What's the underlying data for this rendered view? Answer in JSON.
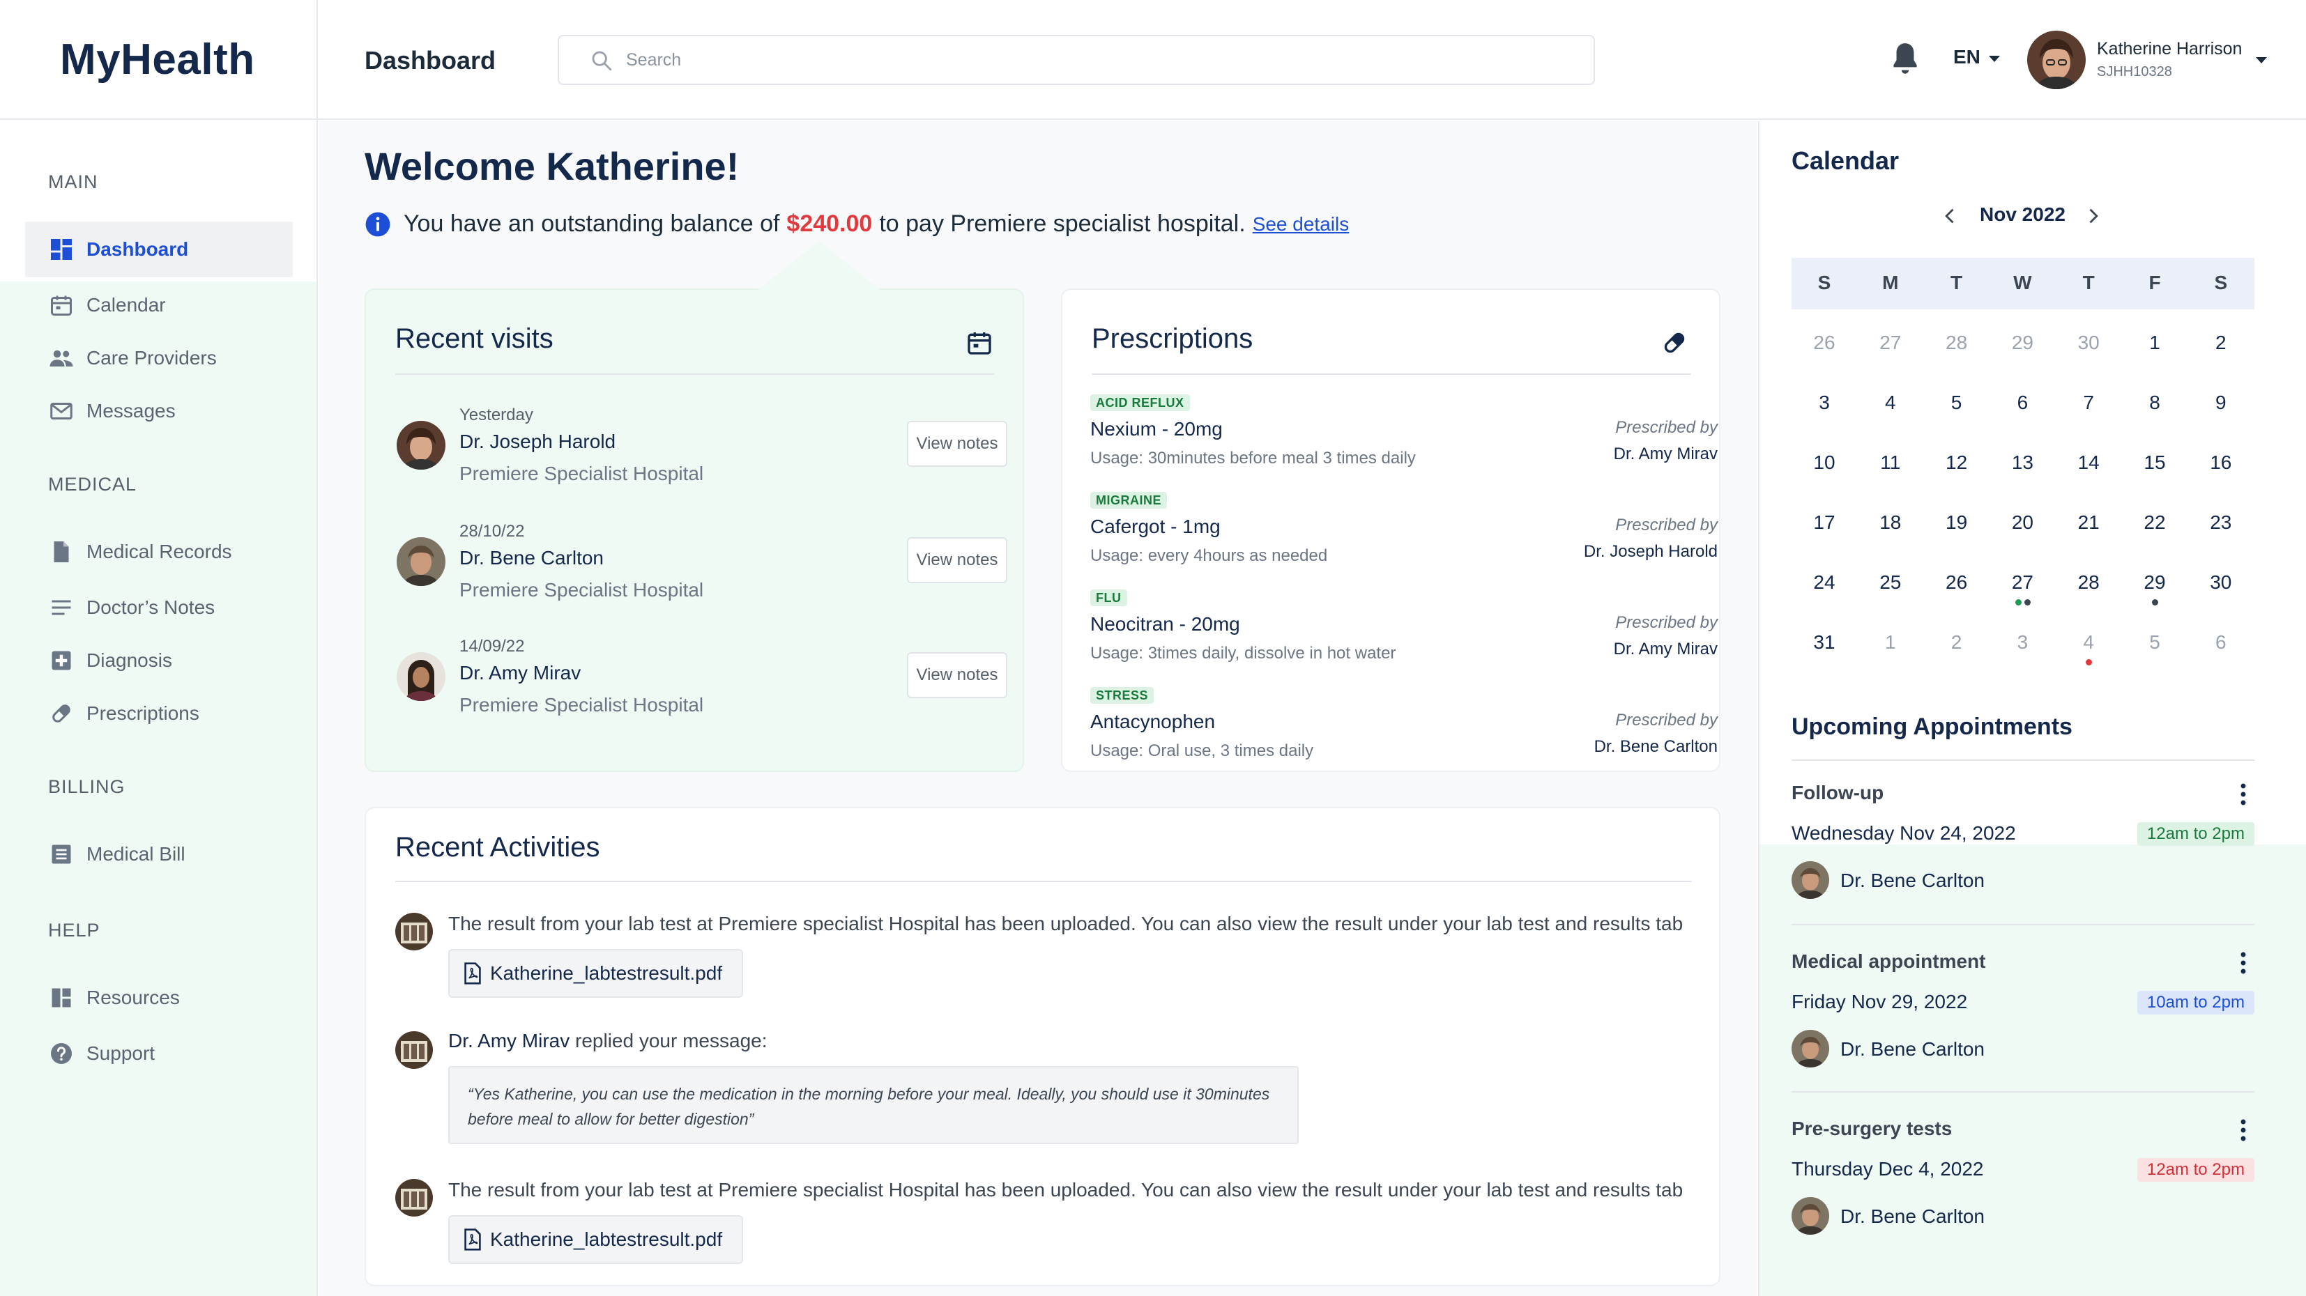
{
  "app": {
    "brand": "MyHealth",
    "page_title": "Dashboard"
  },
  "search": {
    "placeholder": "Search"
  },
  "header": {
    "language": "EN",
    "user_name": "Katherine Harrison",
    "user_id": "SJHH10328"
  },
  "sidebar": {
    "sections": [
      "MAIN",
      "MEDICAL",
      "BILLING",
      "HELP"
    ],
    "items": [
      {
        "label": "Dashboard",
        "icon": "dashboard-icon"
      },
      {
        "label": "Calendar",
        "icon": "calendar-icon"
      },
      {
        "label": "Care Providers",
        "icon": "people-icon"
      },
      {
        "label": "Messages",
        "icon": "mail-icon"
      },
      {
        "label": "Medical Records",
        "icon": "document-icon"
      },
      {
        "label": "Doctor’s Notes",
        "icon": "notes-icon"
      },
      {
        "label": "Diagnosis",
        "icon": "medical-plus-icon"
      },
      {
        "label": "Prescriptions",
        "icon": "pill-icon"
      },
      {
        "label": "Medical Bill",
        "icon": "bill-icon"
      },
      {
        "label": "Resources",
        "icon": "resources-icon"
      },
      {
        "label": "Support",
        "icon": "help-icon"
      }
    ]
  },
  "welcome": {
    "title": "Welcome Katherine!",
    "balance_prefix": "You have an outstanding balance of",
    "balance_amount": "$240.00",
    "balance_suffix": "to pay Premiere specialist hospital.",
    "details_link": "See details"
  },
  "recent_visits": {
    "title": "Recent visits",
    "button_label": "View notes",
    "items": [
      {
        "date": "Yesterday",
        "doctor": "Dr. Joseph Harold",
        "hospital": "Premiere Specialist Hospital"
      },
      {
        "date": "28/10/22",
        "doctor": "Dr. Bene Carlton",
        "hospital": "Premiere Specialist Hospital"
      },
      {
        "date": "14/09/22",
        "doctor": "Dr. Amy Mirav",
        "hospital": "Premiere Specialist Hospital"
      }
    ]
  },
  "prescriptions": {
    "title": "Prescriptions",
    "prescribed_by_label": "Prescribed by",
    "items": [
      {
        "tag": "ACID REFLUX",
        "name": "Nexium - 20mg",
        "usage": "Usage: 30minutes before meal 3 times daily",
        "doctor": "Dr. Amy Mirav"
      },
      {
        "tag": "MIGRAINE",
        "name": "Cafergot - 1mg",
        "usage": "Usage: every 4hours as needed",
        "doctor": "Dr. Joseph Harold"
      },
      {
        "tag": "FLU",
        "name": "Neocitran - 20mg",
        "usage": "Usage: 3times daily, dissolve in hot water",
        "doctor": "Dr. Amy Mirav"
      },
      {
        "tag": "STRESS",
        "name": "Antacynophen",
        "usage": "Usage: Oral use, 3 times daily",
        "doctor": "Dr. Bene Carlton"
      }
    ]
  },
  "activities": {
    "title": "Recent Activities",
    "items": [
      {
        "text": "The result from your lab test at Premiere specialist Hospital has been uploaded. You can also view the result under your lab test and results tab",
        "file": "Katherine_labtestresult.pdf"
      },
      {
        "author": "Dr. Amy Mirav",
        "text": "replied your message:",
        "quote": "“Yes Katherine, you can use the medication in the morning before your meal. Ideally, you should use it 30minutes before meal to allow for better digestion”"
      },
      {
        "text": "The result from your lab test at Premiere specialist Hospital has been uploaded. You can also view the result under your lab test and results tab",
        "file": "Katherine_labtestresult.pdf"
      }
    ]
  },
  "calendar": {
    "title": "Calendar",
    "month": "Nov 2022",
    "weekdays": [
      "S",
      "M",
      "T",
      "W",
      "T",
      "F",
      "S"
    ],
    "weeks": [
      [
        {
          "d": "26",
          "m": true
        },
        {
          "d": "27",
          "m": true
        },
        {
          "d": "28",
          "m": true
        },
        {
          "d": "29",
          "m": true
        },
        {
          "d": "30",
          "m": true
        },
        {
          "d": "1"
        },
        {
          "d": "2"
        }
      ],
      [
        {
          "d": "3"
        },
        {
          "d": "4"
        },
        {
          "d": "5"
        },
        {
          "d": "6"
        },
        {
          "d": "7"
        },
        {
          "d": "8"
        },
        {
          "d": "9"
        }
      ],
      [
        {
          "d": "10"
        },
        {
          "d": "11"
        },
        {
          "d": "12"
        },
        {
          "d": "13"
        },
        {
          "d": "14"
        },
        {
          "d": "15"
        },
        {
          "d": "16"
        }
      ],
      [
        {
          "d": "17"
        },
        {
          "d": "18"
        },
        {
          "d": "19"
        },
        {
          "d": "20"
        },
        {
          "d": "21"
        },
        {
          "d": "22"
        },
        {
          "d": "23"
        }
      ],
      [
        {
          "d": "24"
        },
        {
          "d": "25"
        },
        {
          "d": "26"
        },
        {
          "d": "27",
          "dots": [
            "#1a9a55",
            "#3b4652"
          ]
        },
        {
          "d": "28"
        },
        {
          "d": "29",
          "dots": [
            "#3b4652"
          ]
        },
        {
          "d": "30"
        }
      ],
      [
        {
          "d": "31"
        },
        {
          "d": "1",
          "m": true
        },
        {
          "d": "2",
          "m": true
        },
        {
          "d": "3",
          "m": true
        },
        {
          "d": "4",
          "m": true,
          "dots": [
            "#e0393e"
          ]
        },
        {
          "d": "5",
          "m": true
        },
        {
          "d": "6",
          "m": true
        }
      ]
    ]
  },
  "appointments": {
    "title": "Upcoming Appointments",
    "items": [
      {
        "name": "Follow-up",
        "date": "Wednesday Nov 24, 2022",
        "time": "12am to 2pm",
        "style": "green",
        "doctor": "Dr. Bene Carlton"
      },
      {
        "name": "Medical appointment",
        "date": "Friday Nov 29, 2022",
        "time": "10am to 2pm",
        "style": "blue",
        "doctor": "Dr. Bene Carlton"
      },
      {
        "name": "Pre-surgery tests",
        "date": "Thursday Dec 4, 2022",
        "time": "12am to 2pm",
        "style": "red",
        "doctor": "Dr. Bene Carlton"
      }
    ]
  },
  "colors": {
    "brand": "#14284b",
    "accent": "#1c4fd6",
    "danger": "#e0393e",
    "success": "#1a7a3e",
    "sidebar_bg": "#effaf5"
  }
}
